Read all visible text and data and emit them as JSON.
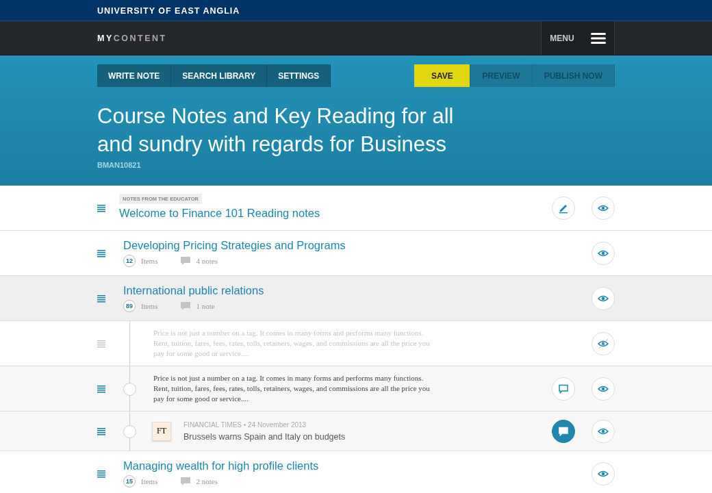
{
  "brand": "UNIVERSITY OF EAST ANGLIA",
  "nav": {
    "logo_bold": "MY",
    "logo_light": "CONTENT",
    "menu": "MENU"
  },
  "tabs": [
    {
      "label": "WRITE NOTE"
    },
    {
      "label": "SEARCH LIBRARY"
    },
    {
      "label": "SETTINGS"
    }
  ],
  "actions": [
    {
      "label": "SAVE",
      "disabled": false
    },
    {
      "label": "PREVIEW",
      "disabled": true
    },
    {
      "label": "PUBLISH NOW",
      "disabled": true
    }
  ],
  "title": "Course Notes and  Key Reading for all and sundry with regards for Business",
  "code": "BMAN10821",
  "rows": [
    {
      "kind": "section",
      "label": "NOTES FROM THE EDUCATOR",
      "title": "Welcome to Finance 101 Reading notes",
      "editable": true,
      "selected": false
    },
    {
      "kind": "section",
      "title": "Developing Pricing Strategies and Programs",
      "count": "12",
      "items": "Items",
      "notes": "4 notes",
      "editable": false,
      "selected": false
    },
    {
      "kind": "section",
      "title": "International public relations",
      "count": "89",
      "items": "Items",
      "notes": "1 note",
      "editable": false,
      "selected": true,
      "children": [
        {
          "kind": "note",
          "text": "Price is not just a number on a tag. It comes in many forms and performs many functions. Rent, tuition, fares, fees, rates, tolls, retainers, wages, and commissions are all the price you pay for some good or service....",
          "hidden": true
        },
        {
          "kind": "note",
          "text": "Price is not just a number on a tag. It comes in many forms and performs many functions. Rent, tuition, fares, fees, rates, tolls, retainers, wages, and commissions are all the price you pay for some good or service....",
          "hidden": false,
          "comment_active": false
        },
        {
          "kind": "article",
          "logo": "FT",
          "source": "FINANCIAL TIMES",
          "date": "• 24 November 2013",
          "headline": "Brussels warns Spain and Italy on budgets",
          "hidden": false,
          "comment_active": true
        }
      ]
    },
    {
      "kind": "section",
      "title": "Managing wealth for high profile clients",
      "count": "15",
      "items": "Items",
      "notes": "2 notes",
      "editable": false,
      "selected": false
    }
  ]
}
